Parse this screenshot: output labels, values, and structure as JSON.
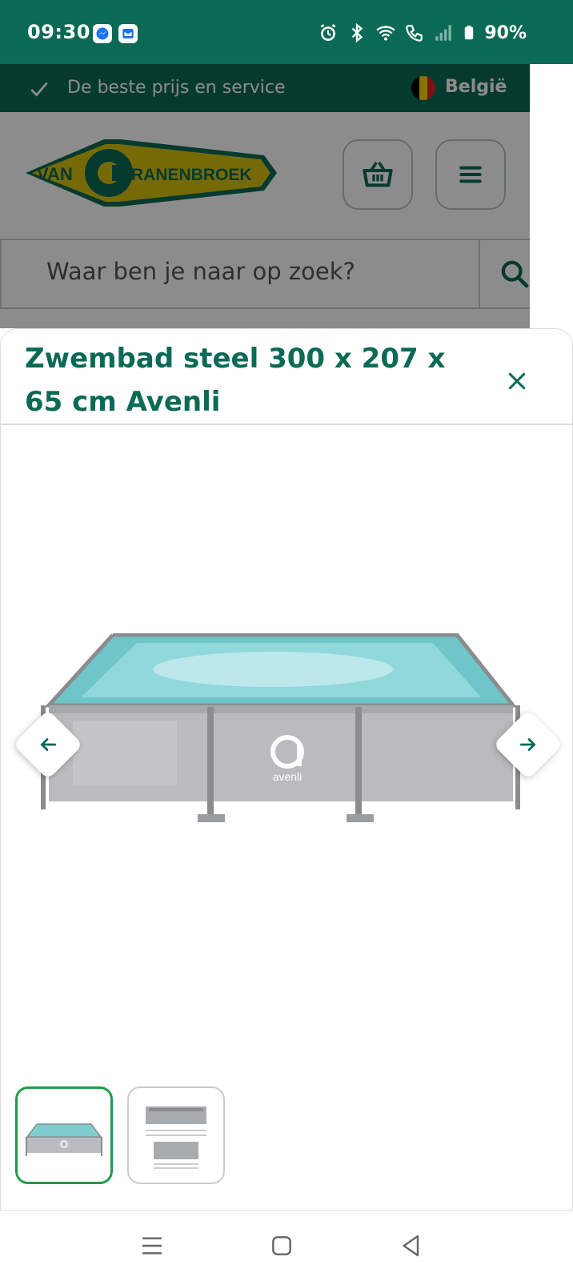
{
  "status_bar": {
    "time": "09:30",
    "battery": "90%",
    "icons": [
      "messenger-icon",
      "mail-icon",
      "alarm-icon",
      "bluetooth-icon",
      "wifi-icon",
      "wifi-call-icon",
      "signal-icon",
      "battery-icon"
    ]
  },
  "topbar": {
    "service_text": "De beste prijs en service",
    "country": "België"
  },
  "header": {
    "logo_text_left": "VAN",
    "logo_text_c": "C",
    "logo_text_right": "RANENBROEK",
    "basket_icon": "basket-icon",
    "menu_icon": "hamburger-menu-icon"
  },
  "search": {
    "placeholder": "Waar ben je naar op zoek?"
  },
  "modal": {
    "title": "Zwembad steel 300 x 207 x 65 cm Avenli",
    "brand_on_image": "avenli"
  },
  "gallery": {
    "thumbnails": [
      "product-photo",
      "dimension-drawing"
    ],
    "selected_index": 0
  },
  "colors": {
    "brand_green": "#0b6a55",
    "accent_green": "#1f9c4a",
    "logo_yellow": "#d8c20e"
  }
}
